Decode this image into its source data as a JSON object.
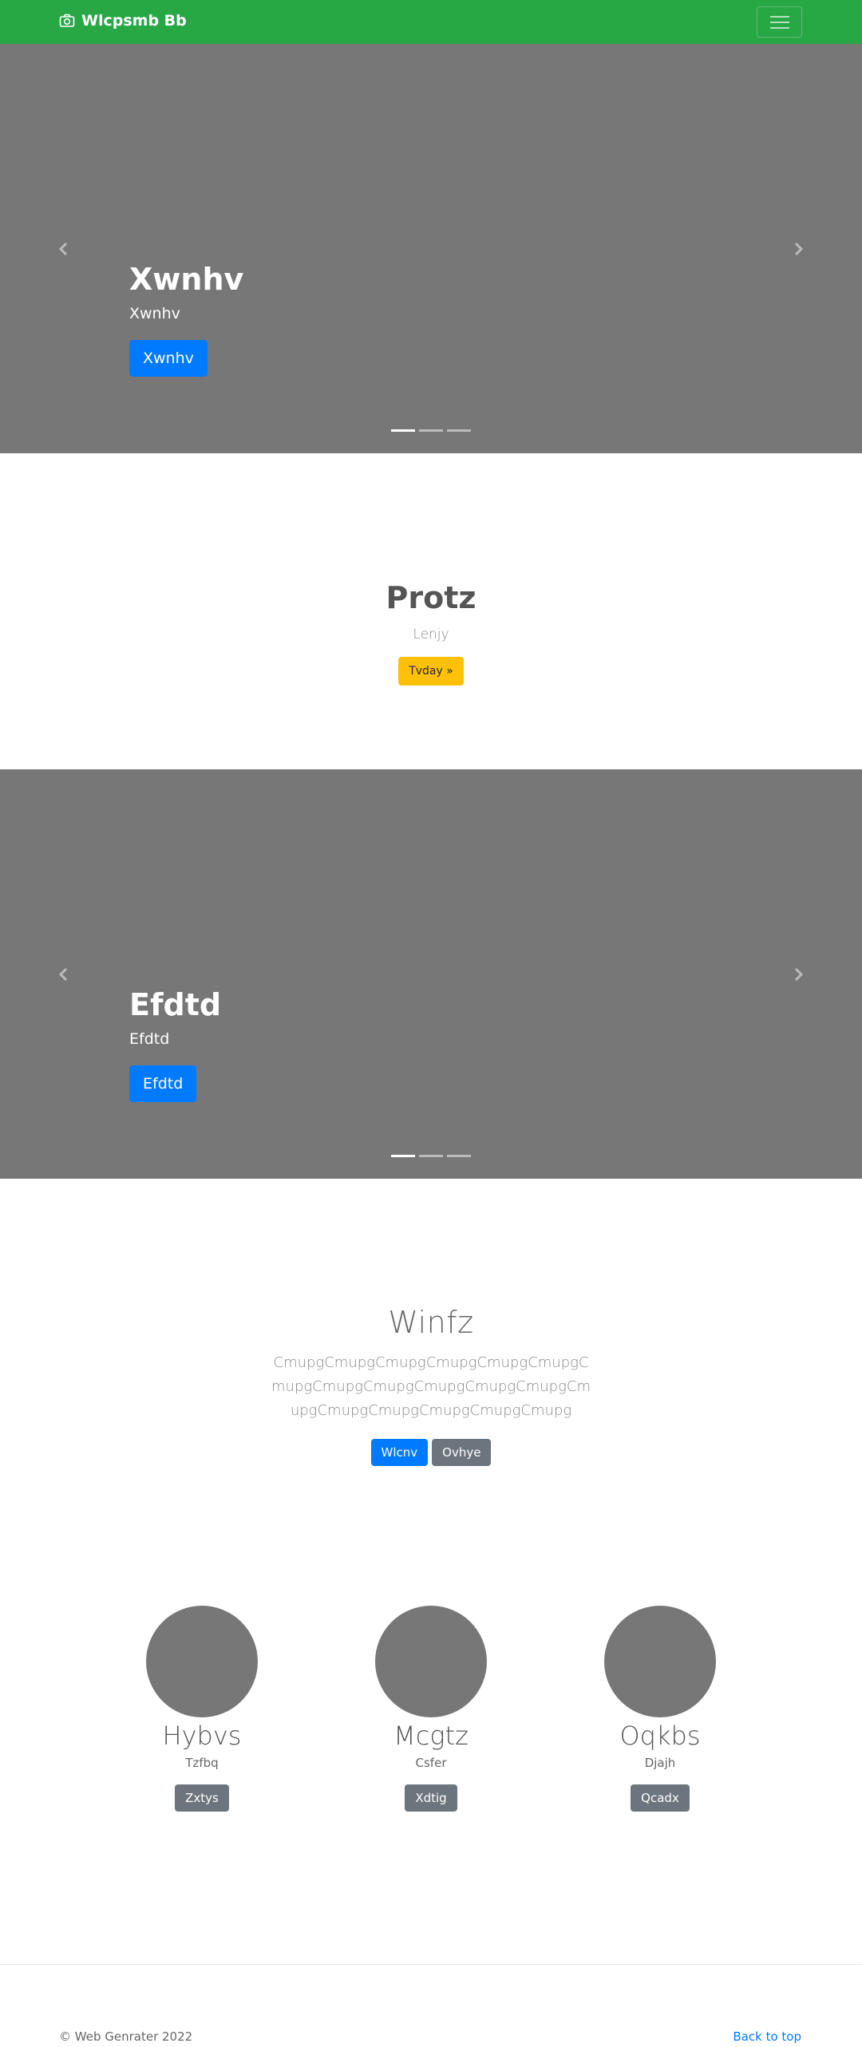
{
  "navbar": {
    "brand": "Wlcpsmb Bb",
    "brand_icon": "camera-icon",
    "toggler_icon": "hamburger-menu-icon",
    "color": "#28a745"
  },
  "carousel1": {
    "title": "Xwnhv",
    "text": "Xwnhv",
    "button": "Xwnhv",
    "slides": 3,
    "active_slide": 1
  },
  "protz": {
    "title": "Protz",
    "subtitle": "Lenjy",
    "button": "Tvday »"
  },
  "carousel2": {
    "title": "Efdtd",
    "text": "Efdtd",
    "button": "Efdtd",
    "slides": 3,
    "active_slide": 1
  },
  "winfz": {
    "title": "Winfz",
    "lead": "CmupgCmupgCmupgCmupgCmupgCmupgCmupgCmupgCmupgCmupgCmupgCmupgCmupgCmupgCmupgCmupgCmupgCmupg",
    "primary_button": "Wlcnv",
    "secondary_button": "Ovhye"
  },
  "columns": [
    {
      "title": "Hybvs",
      "text": "Tzfbq",
      "button": "Zxtys"
    },
    {
      "title": "Mcgtz",
      "text": "Csfer",
      "button": "Xdtig"
    },
    {
      "title": "Oqkbs",
      "text": "Djajh",
      "button": "Qcadx"
    }
  ],
  "footer": {
    "copyright": "© Web Genrater 2022",
    "back_to_top": "Back to top"
  }
}
